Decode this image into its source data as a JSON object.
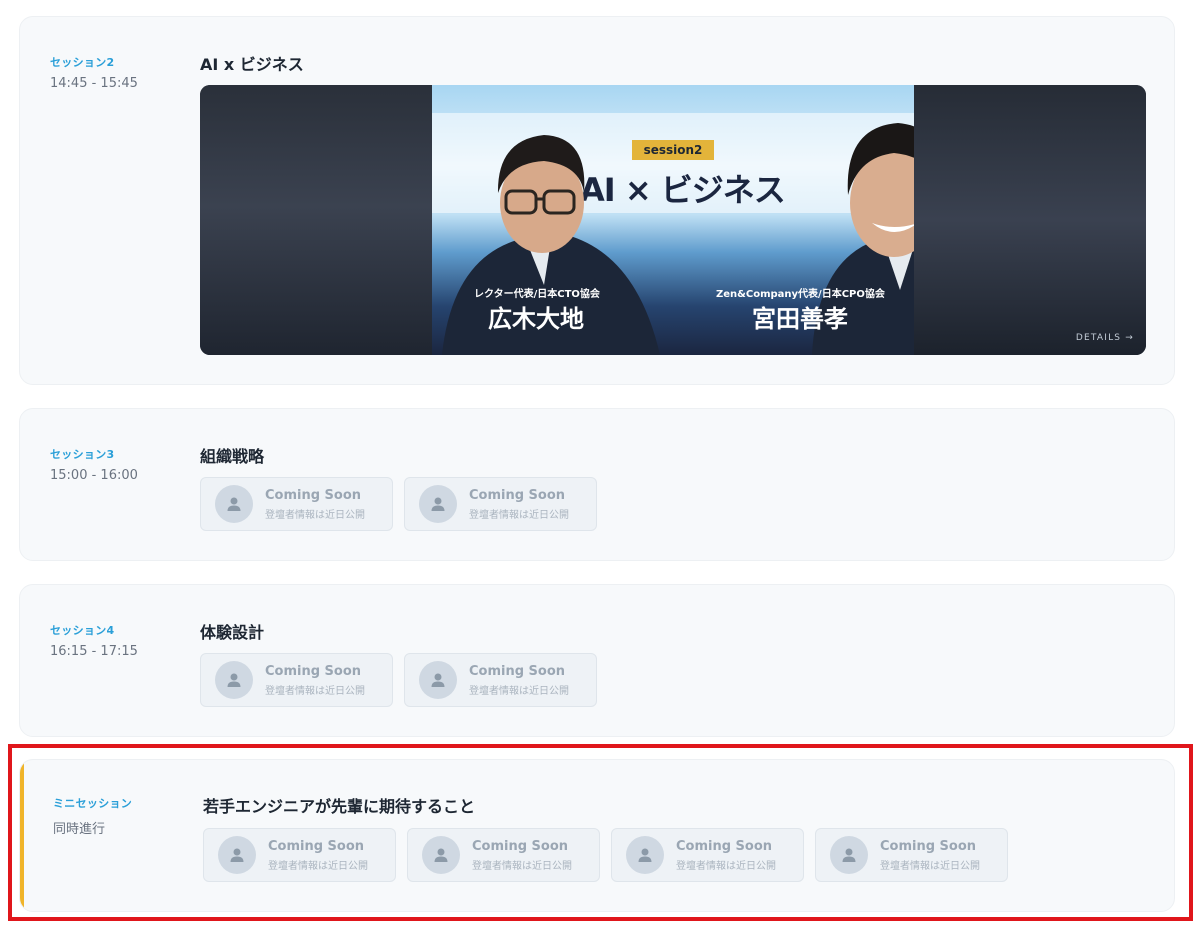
{
  "sessions": [
    {
      "label": "セッション2",
      "time": "14:45 - 15:45",
      "title": "AI x ビジネス",
      "banner": {
        "tag": "session2",
        "title": "AI × ビジネス",
        "speakers": [
          {
            "role": "レクター代表/日本CTO協会",
            "name": "広木大地"
          },
          {
            "role": "Zen&Company代表/日本CPO協会",
            "name": "宮田善孝"
          }
        ],
        "details_link": "DETAILS →"
      }
    },
    {
      "label": "セッション3",
      "time": "15:00 - 16:00",
      "title": "組織戦略",
      "speakers": [
        {
          "main": "Coming Soon",
          "sub": "登壇者情報は近日公開"
        },
        {
          "main": "Coming Soon",
          "sub": "登壇者情報は近日公開"
        }
      ]
    },
    {
      "label": "セッション4",
      "time": "16:15 - 17:15",
      "title": "体験設計",
      "speakers": [
        {
          "main": "Coming Soon",
          "sub": "登壇者情報は近日公開"
        },
        {
          "main": "Coming Soon",
          "sub": "登壇者情報は近日公開"
        }
      ]
    },
    {
      "label": "ミニセッション",
      "time": "同時進行",
      "title": "若手エンジニアが先輩に期待すること",
      "speakers": [
        {
          "main": "Coming Soon",
          "sub": "登壇者情報は近日公開"
        },
        {
          "main": "Coming Soon",
          "sub": "登壇者情報は近日公開"
        },
        {
          "main": "Coming Soon",
          "sub": "登壇者情報は近日公開"
        },
        {
          "main": "Coming Soon",
          "sub": "登壇者情報は近日公開"
        }
      ]
    }
  ],
  "colors": {
    "accent_blue": "#2a9fd8",
    "highlight_border": "#e0161b",
    "mini_session_bar": "#f0b429",
    "session_tag": "#e3b43a"
  },
  "icons": {
    "avatar": "user-placeholder-icon"
  }
}
